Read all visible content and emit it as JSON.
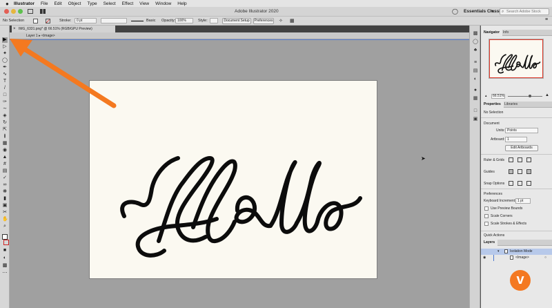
{
  "menubar": {
    "apple": "",
    "items": [
      "Illustrator",
      "File",
      "Edit",
      "Object",
      "Type",
      "Select",
      "Effect",
      "View",
      "Window",
      "Help"
    ]
  },
  "titlebar": {
    "title": "Adobe Illustrator 2020",
    "workspace": "Essentials Classic",
    "search_placeholder": "Search Adobe Stock"
  },
  "control_bar": {
    "selection": "No Selection",
    "stroke_label": "Stroke:",
    "stroke_value": "0 pt",
    "brush": "Basic",
    "opacity_label": "Opacity:",
    "opacity_value": "100%",
    "style_label": "Style:",
    "document_setup": "Document Setup",
    "preferences": "Preferences"
  },
  "document": {
    "tab_title": "IMG_6331.png* @ 66.51% (RGB/GPU Preview)",
    "breadcrumb_layer": "Layer 1",
    "breadcrumb_image": "<Image>",
    "artwork_text": "Hello"
  },
  "panels": {
    "navigator_tab": "Navigator",
    "info_tab": "Info",
    "zoom_value": "66.51%",
    "properties_tab": "Properties",
    "libraries_tab": "Libraries",
    "no_selection": "No Selection",
    "document_heading": "Document",
    "units_label": "Units:",
    "units_value": "Points",
    "artboard_label": "Artboard:",
    "artboard_value": "1",
    "edit_artboards": "Edit Artboards",
    "ruler_grids": "Ruler & Grids",
    "guides": "Guides",
    "snap_options": "Snap Options",
    "preferences_heading": "Preferences",
    "keyboard_increment_label": "Keyboard Increment:",
    "keyboard_increment_value": "1 pt",
    "use_preview_bounds": "Use Preview Bounds",
    "scale_corners": "Scale Corners",
    "scale_strokes": "Scale Strokes & Effects",
    "quick_actions": "Quick Actions",
    "layers_tab": "Layers",
    "layer_row_1": "Isolation Mode",
    "layer_row_2": "<Image>"
  },
  "colors": {
    "arrow": "#f47920",
    "accent_blue": "#5a7fd0",
    "vimeo_badge": "#f47821"
  }
}
